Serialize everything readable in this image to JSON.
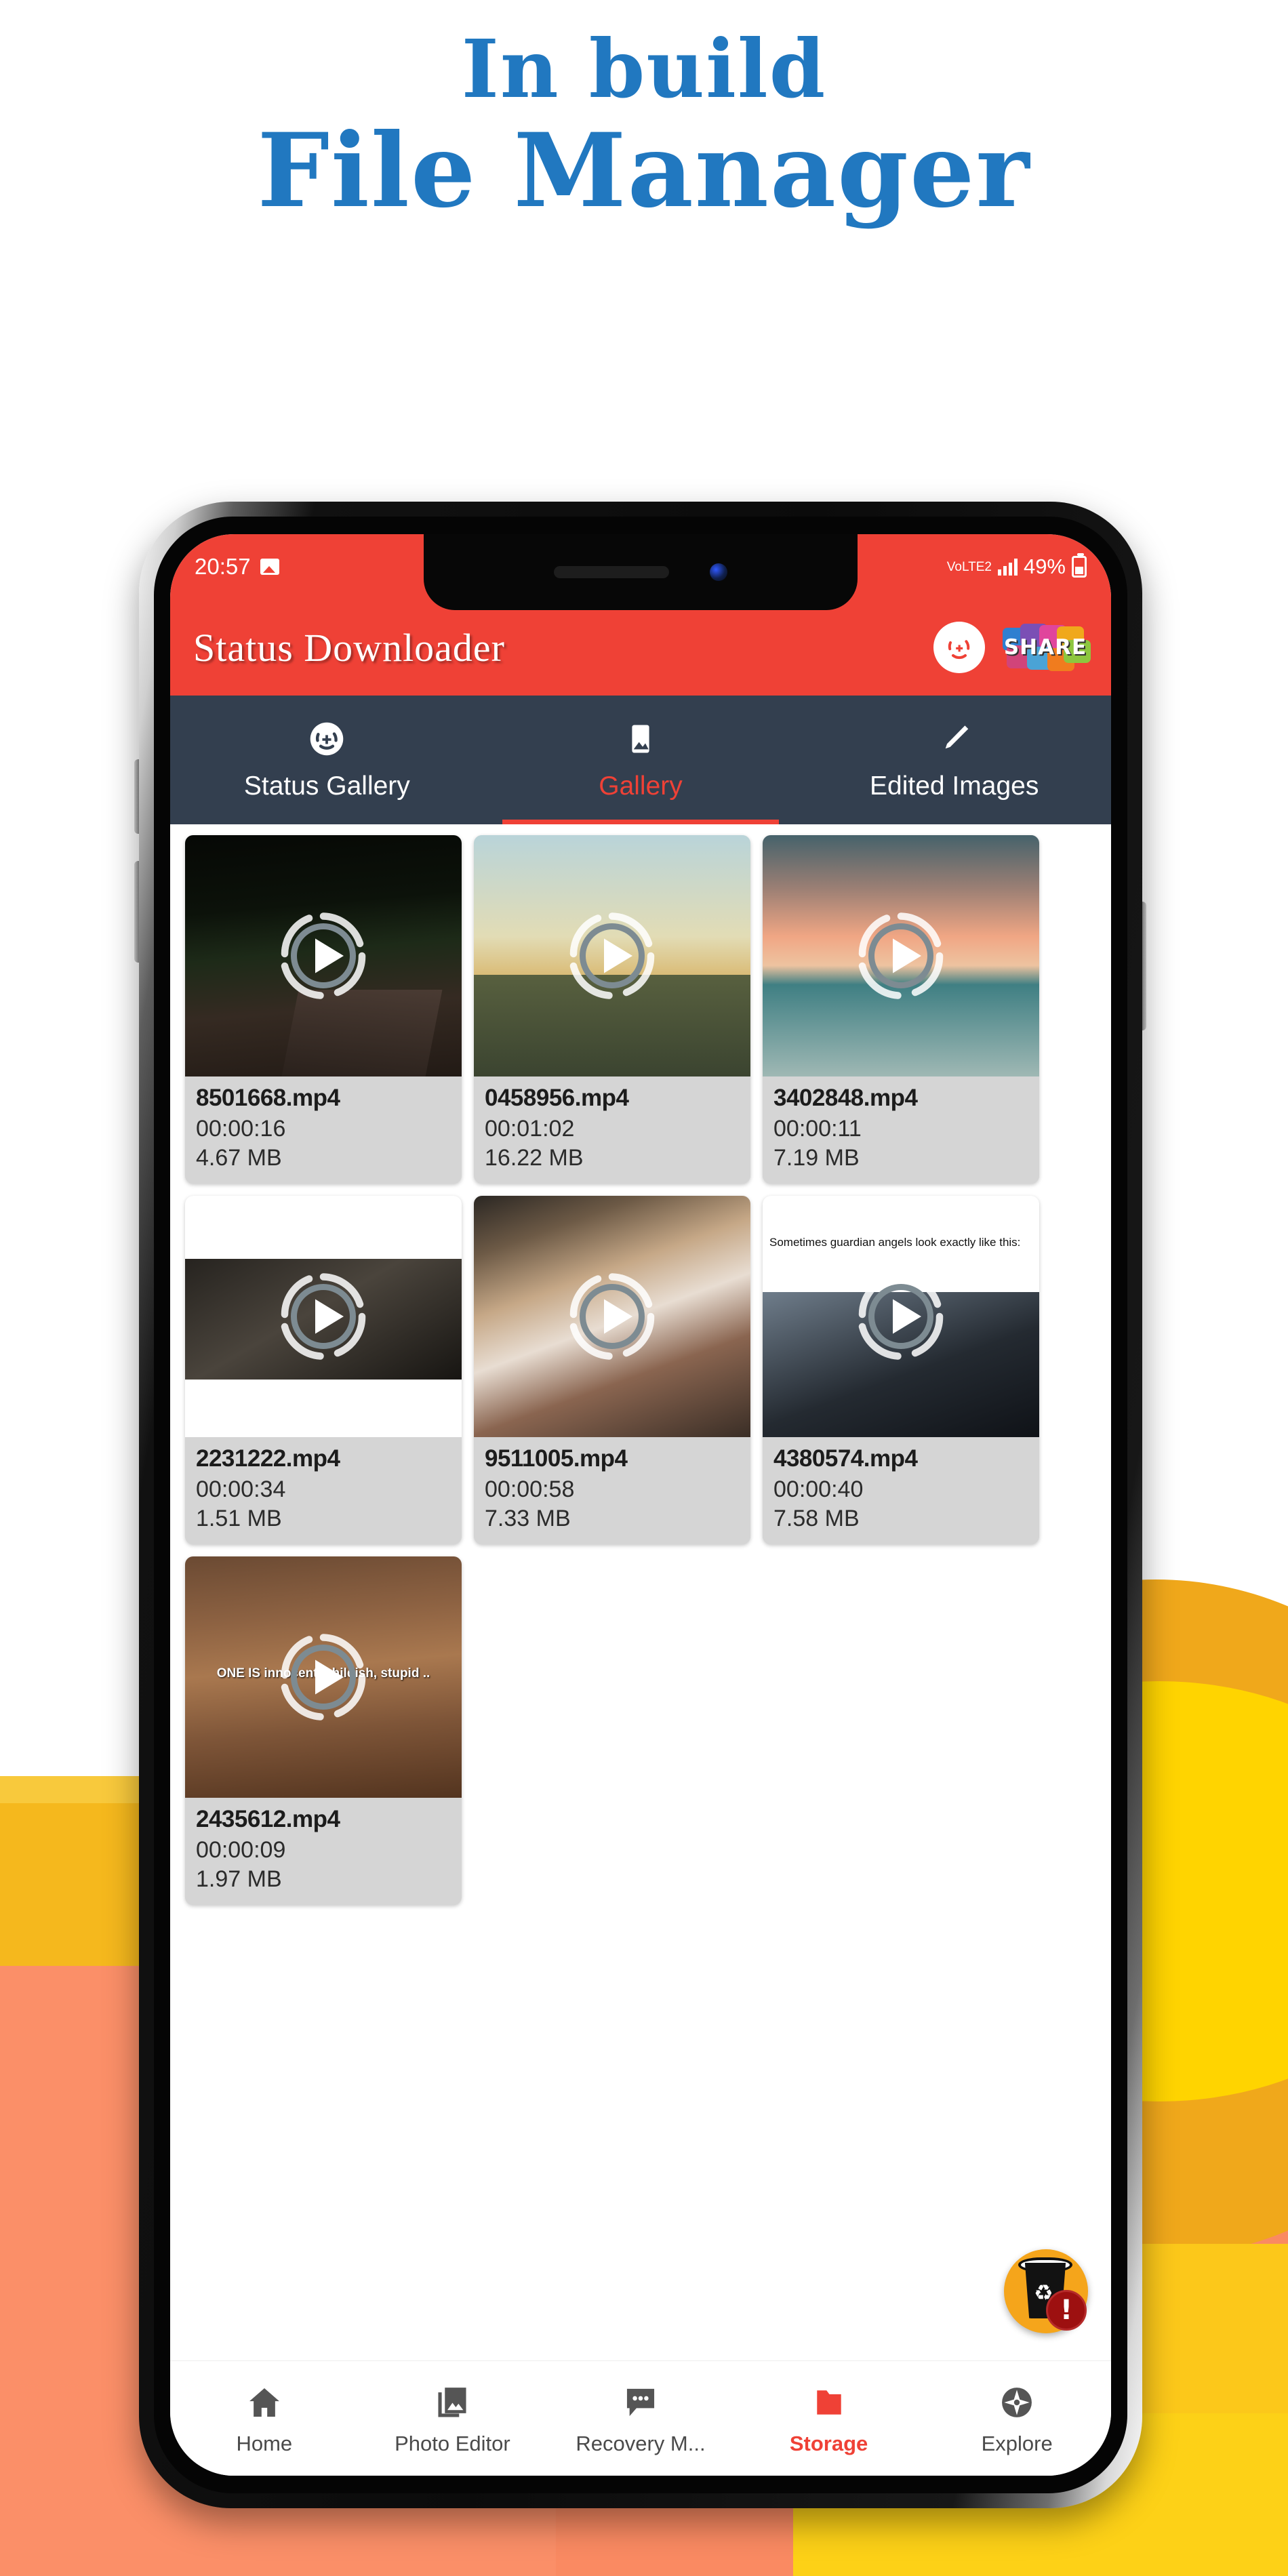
{
  "poster": {
    "line1": "In build",
    "line2": "File Manager",
    "accent_color": "#2178c0"
  },
  "phone": {
    "statusbar": {
      "time": "20:57",
      "photo_icon": "photo-icon",
      "network_label": "VoLTE2",
      "battery_percent": "49%"
    },
    "appbar": {
      "title": "Status Downloader",
      "refresh_icon": "status-refresh-icon",
      "share_label": "SHARE"
    },
    "tabs": [
      {
        "label": "Status Gallery",
        "icon": "status-sync-icon",
        "active": false
      },
      {
        "label": "Gallery",
        "icon": "image-icon",
        "active": true
      },
      {
        "label": "Edited Images",
        "icon": "pencil-icon",
        "active": false
      }
    ],
    "files": [
      {
        "name": "8501668.mp4",
        "duration": "00:00:16",
        "size": "4.67 MB",
        "art": "art-road",
        "caption": ""
      },
      {
        "name": "0458956.mp4",
        "duration": "00:01:02",
        "size": "16.22 MB",
        "art": "art-street",
        "caption": ""
      },
      {
        "name": "3402848.mp4",
        "duration": "00:00:11",
        "size": "7.19 MB",
        "art": "art-sea",
        "caption": ""
      },
      {
        "name": "2231222.mp4",
        "duration": "00:00:34",
        "size": "1.51 MB",
        "art": "art-white1",
        "caption": ""
      },
      {
        "name": "9511005.mp4",
        "duration": "00:00:58",
        "size": "7.33 MB",
        "art": "art-girl",
        "caption": ""
      },
      {
        "name": "4380574.mp4",
        "duration": "00:00:40",
        "size": "7.58 MB",
        "art": "art-angels",
        "caption": "Sometimes guardian angels look exactly like this:"
      },
      {
        "name": "2435612.mp4",
        "duration": "00:00:09",
        "size": "1.97 MB",
        "art": "art-lion",
        "caption": "ONE IS innocent, childish, stupid .."
      }
    ],
    "fab": {
      "icon": "recycle-bin-icon",
      "badge": "!"
    },
    "bottom_nav": [
      {
        "label": "Home",
        "icon": "home-icon",
        "active": false
      },
      {
        "label": "Photo Editor",
        "icon": "photos-icon",
        "active": false
      },
      {
        "label": "Recovery M...",
        "icon": "chat-icon",
        "active": false
      },
      {
        "label": "Storage",
        "icon": "folder-icon",
        "active": true
      },
      {
        "label": "Explore",
        "icon": "compass-icon",
        "active": false
      }
    ]
  }
}
